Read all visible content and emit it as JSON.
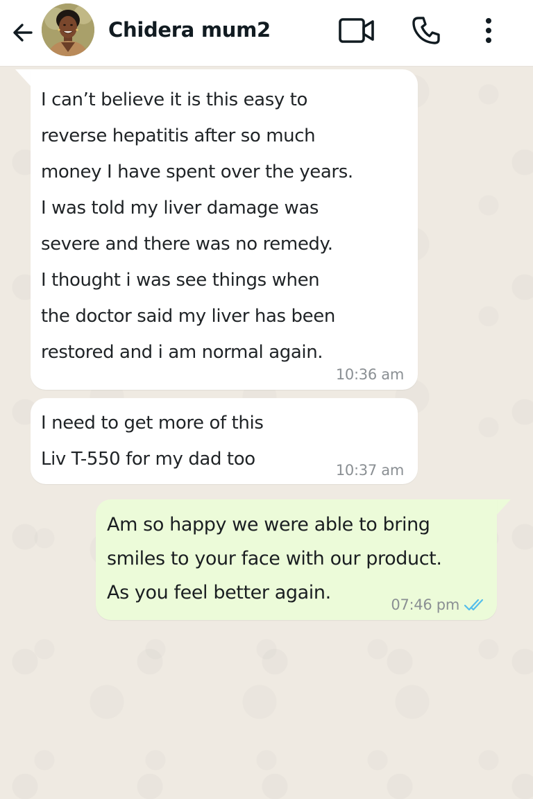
{
  "header": {
    "contact_name": "Chidera mum2",
    "avatar_icon": "contact-avatar",
    "back_icon": "arrow-left-icon",
    "video_icon": "video-camera-icon",
    "call_icon": "phone-icon",
    "menu_icon": "more-vertical-icon"
  },
  "messages": [
    {
      "direction": "incoming",
      "text": "I can’t believe it is this easy to\nreverse hepatitis after so much\nmoney I have spent over the years.\nI was told my liver damage was\nsevere and there was no remedy.\nI thought i was see things when\nthe doctor said my liver has been\nrestored and i am normal again.",
      "time": "10:36 am"
    },
    {
      "direction": "incoming",
      "text": "I need to get more of this\nLiv T-550 for my dad too",
      "time": "10:37 am"
    },
    {
      "direction": "outgoing",
      "text": "Am so happy we were able to bring\nsmiles to your face with our product.\nAs you feel better again.",
      "time": "07:46 pm",
      "status": "read",
      "status_icon": "double-check-icon"
    }
  ],
  "colors": {
    "background": "#efeae2",
    "incoming_bubble": "#ffffff",
    "outgoing_bubble": "#ecfbd9",
    "read_ticks": "#53bdeb",
    "timestamp": "#8a8f93"
  }
}
